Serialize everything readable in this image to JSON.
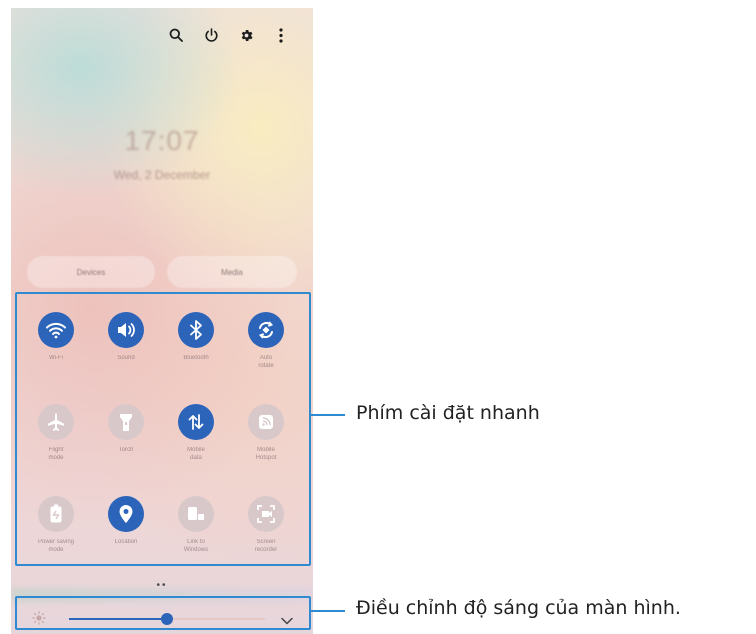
{
  "header": {
    "icons": [
      "search-icon",
      "power-icon",
      "gear-icon",
      "more-vert-icon"
    ]
  },
  "lockscreen": {
    "time": "17:07",
    "date": "Wed, 2 December"
  },
  "panel_buttons": {
    "devices": "Devices",
    "media": "Media"
  },
  "quick_settings": {
    "tiles": [
      {
        "label": "Wi-Fi",
        "icon": "wifi-icon",
        "on": true
      },
      {
        "label": "Sound",
        "icon": "sound-icon",
        "on": true
      },
      {
        "label": "Bluetooth",
        "icon": "bluetooth-icon",
        "on": true
      },
      {
        "label": "Auto\nrotate",
        "icon": "auto-rotate-icon",
        "on": true
      },
      {
        "label": "Flight\nmode",
        "icon": "airplane-icon",
        "on": false
      },
      {
        "label": "Torch",
        "icon": "torch-icon",
        "on": false
      },
      {
        "label": "Mobile\ndata",
        "icon": "mobile-data-icon",
        "on": true
      },
      {
        "label": "Mobile\nHotspot",
        "icon": "hotspot-icon",
        "on": false
      },
      {
        "label": "Power saving\nmode",
        "icon": "battery-saver-icon",
        "on": false
      },
      {
        "label": "Location",
        "icon": "location-icon",
        "on": true
      },
      {
        "label": "Link to\nWindows",
        "icon": "link-windows-icon",
        "on": false
      },
      {
        "label": "Screen\nrecorder",
        "icon": "screen-recorder-icon",
        "on": false
      }
    ]
  },
  "pager": {
    "dots": "••"
  },
  "brightness": {
    "level": 0.5,
    "icon": "brightness-icon",
    "expand_icon": "chevron-down-icon"
  },
  "annotations": {
    "quick_settings": "Phím cài đặt nhanh",
    "brightness": "Điều chỉnh độ sáng của màn hình."
  },
  "colors": {
    "accent": "#2b64b9",
    "callout": "#2f8ad0",
    "tile_off": "#d8c8ca"
  }
}
